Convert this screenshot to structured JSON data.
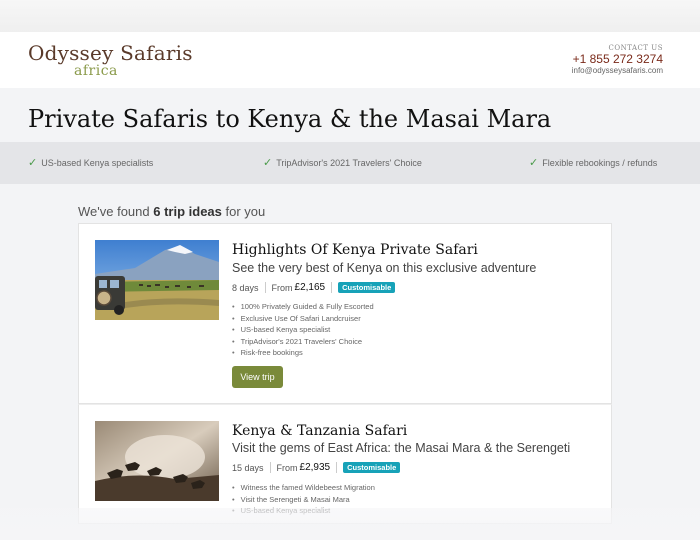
{
  "header": {
    "logo_main": "Odyssey Safaris",
    "logo_sub": "africa",
    "contact_label": "CONTACT US",
    "phone": "+1 855 272 3274",
    "email": "info@odysseysafaris.com"
  },
  "page_title": "Private Safaris to Kenya & the Masai Mara",
  "features": [
    {
      "icon": "check-icon",
      "label": "US-based Kenya specialists"
    },
    {
      "icon": "check-icon",
      "label": "TripAdvisor's 2021 Travelers' Choice"
    },
    {
      "icon": "check-icon",
      "label": "Flexible rebookings / refunds"
    }
  ],
  "results": {
    "prefix": "We've found",
    "count": "6 trip ideas",
    "suffix": "for you"
  },
  "trips": [
    {
      "title": "Highlights Of Kenya Private Safari",
      "subtitle": "See the very best of Kenya on this exclusive adventure",
      "duration": "8 days",
      "from_label": "From",
      "price": "£2,165",
      "badge": "Customisable",
      "bullets": [
        "100% Privately Guided & Fully Escorted",
        "Exclusive Use Of Safari Landcruiser",
        "US-based Kenya specialist",
        "TripAdvisor's 2021 Travelers' Choice",
        "Risk-free bookings"
      ],
      "button": "View trip"
    },
    {
      "title": "Kenya & Tanzania Safari",
      "subtitle": "Visit the gems of East Africa: the Masai Mara & the Serengeti",
      "duration": "15 days",
      "from_label": "From",
      "price": "£2,935",
      "badge": "Customisable",
      "bullets": [
        "Witness the famed Wildebeest Migration",
        "Visit the Serengeti & Masai Mara",
        "US-based Kenya specialist"
      ]
    }
  ],
  "colors": {
    "brand_brown": "#5a3a2a",
    "brand_olive": "#7a8a3a",
    "badge": "#17a2b8",
    "check": "#4a9a4a"
  }
}
